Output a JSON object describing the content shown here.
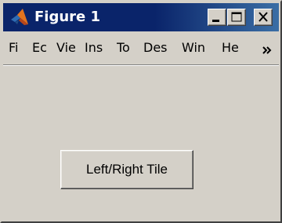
{
  "window": {
    "title": "Figure 1",
    "app_icon": "matlab-logo-icon",
    "caption_buttons": {
      "minimize_icon": "minimize-icon",
      "maximize_icon": "maximize-icon",
      "close_icon": "close-icon"
    }
  },
  "menubar": {
    "items": [
      {
        "label": "Fi"
      },
      {
        "label": "Ec"
      },
      {
        "label": "Vie"
      },
      {
        "label": "Ins"
      },
      {
        "label": "To"
      },
      {
        "label": "Des"
      },
      {
        "label": "Win"
      },
      {
        "label": "He"
      }
    ],
    "overflow_icon": "chevron-double-right-icon"
  },
  "content": {
    "button_label": "Left/Right Tile"
  },
  "colors": {
    "titlebar": "#0a246a",
    "titlebar_gradient_end": "#3a6ea5",
    "face": "#d4d0c8",
    "title_text": "#ffffff"
  }
}
